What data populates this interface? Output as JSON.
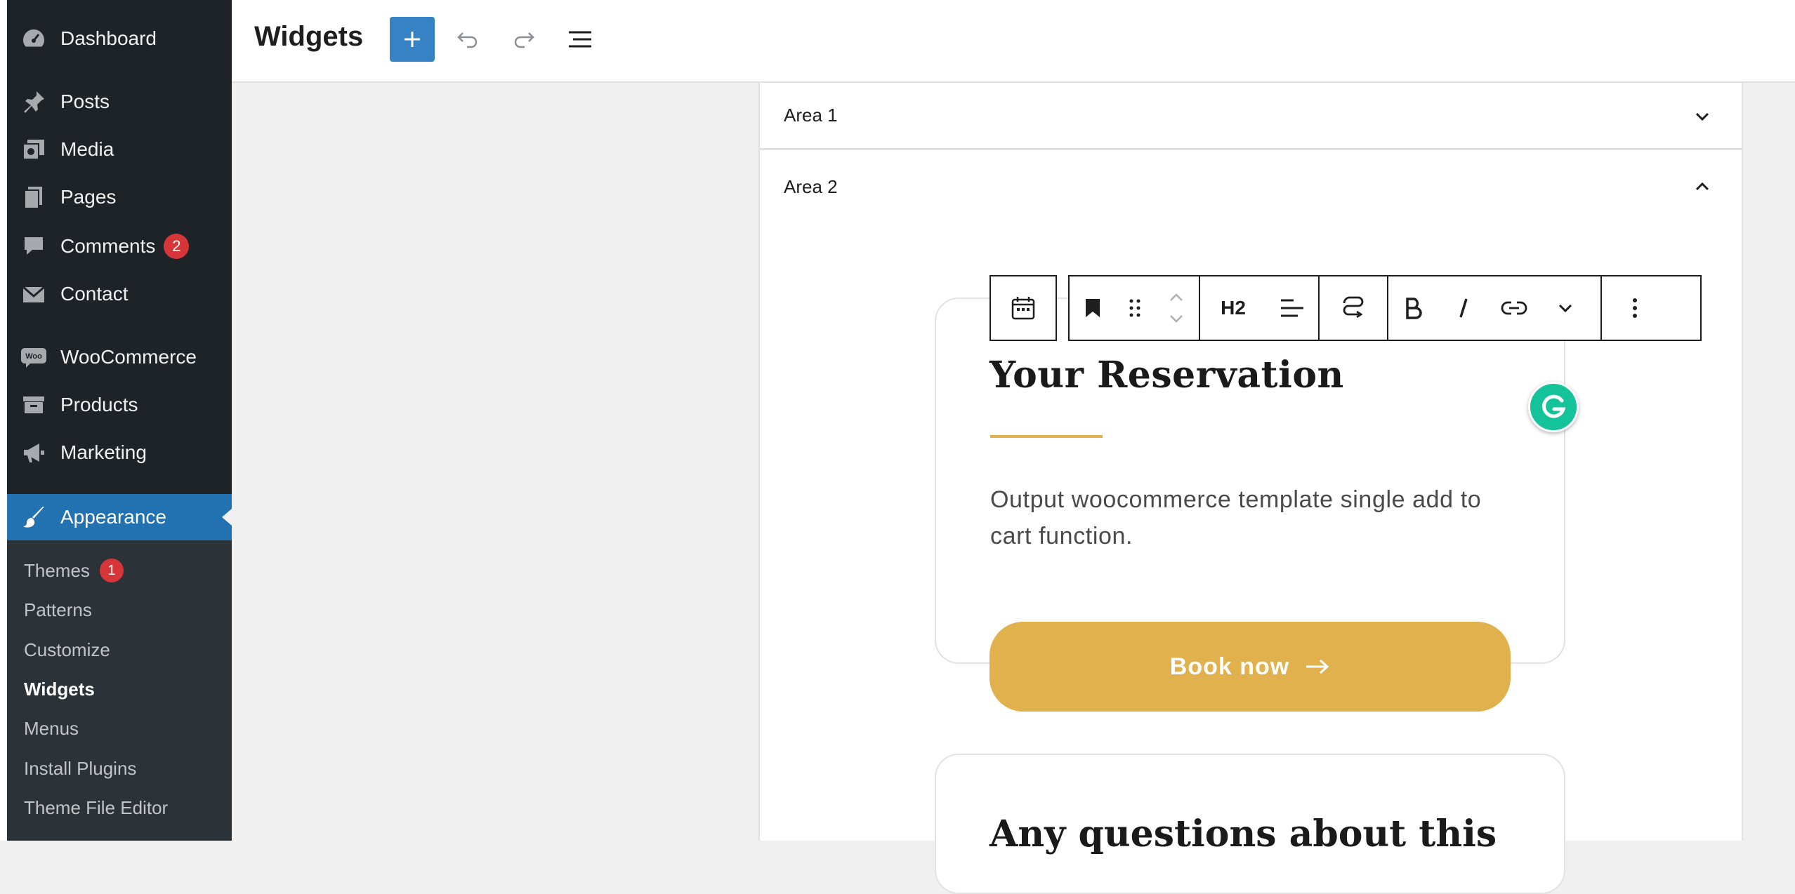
{
  "sidebar": {
    "items": [
      {
        "label": "Dashboard",
        "icon": "dashboard-icon"
      },
      {
        "label": "Posts",
        "icon": "pin-icon"
      },
      {
        "label": "Media",
        "icon": "media-icon"
      },
      {
        "label": "Pages",
        "icon": "pages-icon"
      },
      {
        "label": "Comments",
        "icon": "comment-icon",
        "badge": "2"
      },
      {
        "label": "Contact",
        "icon": "mail-icon"
      },
      {
        "label": "WooCommerce",
        "icon": "woo-icon"
      },
      {
        "label": "Products",
        "icon": "archive-icon"
      },
      {
        "label": "Marketing",
        "icon": "megaphone-icon"
      },
      {
        "label": "Appearance",
        "icon": "brush-icon"
      }
    ],
    "submenu": [
      {
        "label": "Themes",
        "badge": "1"
      },
      {
        "label": "Patterns"
      },
      {
        "label": "Customize"
      },
      {
        "label": "Widgets"
      },
      {
        "label": "Menus"
      },
      {
        "label": "Install Plugins"
      },
      {
        "label": "Theme File Editor"
      }
    ],
    "active_color": "#2271b1",
    "background_color": "#1d2327"
  },
  "header": {
    "title": "Widgets",
    "add_icon": "plus-icon",
    "undo_icon": "undo-icon",
    "redo_icon": "redo-icon",
    "list_view_icon": "list-view-icon",
    "accent_color": "#3582c4"
  },
  "areas": [
    {
      "label": "Area 1",
      "state": "collapsed"
    },
    {
      "label": "Area 2",
      "state": "expanded"
    }
  ],
  "toolbar": {
    "block_type_icon": "calendar-icon",
    "h2_label": "H2",
    "icons": [
      "bookmark-icon",
      "drag-handle-icon",
      "move-up-icon",
      "move-down-icon",
      "align-left-icon",
      "transform-icon",
      "bold-icon",
      "italic-icon",
      "link-icon",
      "more-options-chevron-icon",
      "kebab-menu-icon"
    ]
  },
  "card": {
    "heading": "Your Reservation",
    "text": "Output woocommerce template single add to cart function.",
    "button_label": "Book now",
    "accent_color": "#e0b14c"
  },
  "card2": {
    "heading": "Any questions about this"
  },
  "grammarly": {
    "letter": "G",
    "color": "#15c39a"
  }
}
